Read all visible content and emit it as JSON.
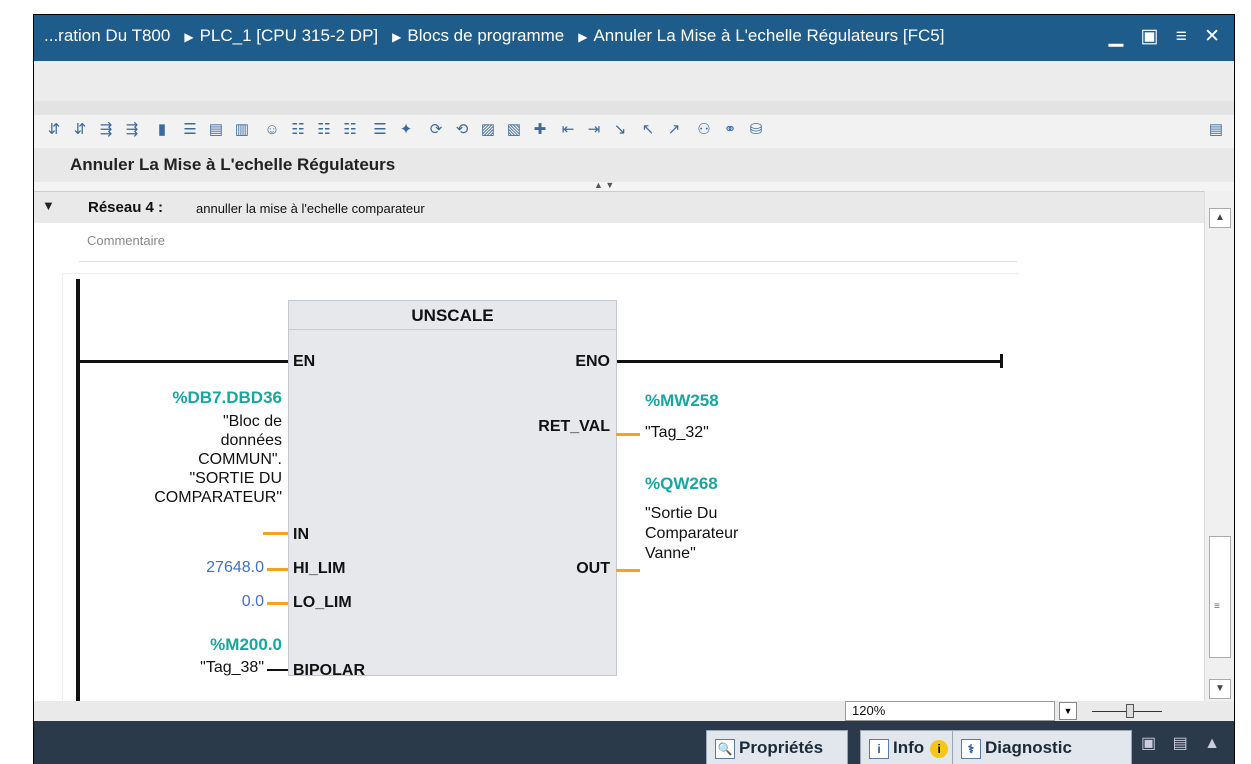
{
  "window": {
    "breadcrumb": [
      "...ration Du T800",
      "PLC_1 [CPU 315-2 DP]",
      "Blocs de programme",
      "Annuler La Mise à L'echelle Régulateurs [FC5]"
    ],
    "separator": "▶",
    "controls": "▁ ▣ ≡ ✕"
  },
  "toolbar": {
    "icons": [
      "⇵",
      "⇵",
      "⇶",
      "⇶",
      "▮",
      "☰",
      "▤",
      "▥",
      "☺",
      "☷",
      "☷",
      "☷",
      "☰",
      "✦",
      "⟳",
      "⟲",
      "▨",
      "▧",
      "✚",
      "⇤",
      "⇥",
      "↘",
      "↖",
      "↗",
      "⚇",
      "⚭",
      "⛁"
    ],
    "right_icon": "▤"
  },
  "block": {
    "title": "Annuler La Mise à L'echelle Régulateurs"
  },
  "network": {
    "toggle": "▼",
    "label": "Réseau 4 :",
    "comment": "annuller la mise à l'echelle comparateur",
    "comment_placeholder": "Commentaire"
  },
  "function_block": {
    "name": "UNSCALE",
    "pins_in": {
      "en": "EN",
      "in": "IN",
      "hi_lim": "HI_LIM",
      "lo_lim": "LO_LIM",
      "bipolar": "BIPOLAR"
    },
    "pins_out": {
      "eno": "ENO",
      "ret_val": "RET_VAL",
      "out": "OUT"
    }
  },
  "operands": {
    "in_addr": "%DB7.DBD36",
    "in_tag_lines": [
      "\"Bloc de",
      "données",
      "COMMUN\".",
      "\"SORTIE DU",
      "COMPARATEUR\""
    ],
    "hi_lim_value": "27648.0",
    "lo_lim_value": "0.0",
    "bipolar_addr": "%M200.0",
    "bipolar_tag": "\"Tag_38\"",
    "ret_val_addr": "%MW258",
    "ret_val_tag": "\"Tag_32\"",
    "out_addr": "%QW268",
    "out_tag_lines": [
      "\"Sortie Du",
      "Comparateur",
      "Vanne\""
    ]
  },
  "scrollbar": {
    "up": "▲",
    "down": "▼",
    "grip": "≡"
  },
  "zoom": {
    "value": "120%",
    "dropdown": "▼"
  },
  "statusbar": {
    "tabs": {
      "properties": "Propriétés",
      "info": "Info",
      "diagnostic": "Diagnostic"
    },
    "info_badge": "i",
    "controls": "▣ ▤ ▲"
  }
}
